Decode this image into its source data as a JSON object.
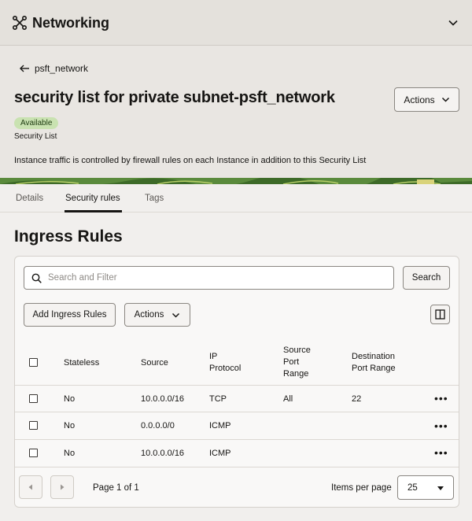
{
  "topbar": {
    "title": "Networking",
    "icon": "network-icon"
  },
  "header": {
    "breadcrumb": "psft_network",
    "title": "security list for private subnet-psft_network",
    "actions_label": "Actions",
    "status": "Available",
    "resource_type": "Security List",
    "note": "Instance traffic is controlled by firewall rules on each Instance in addition to this Security List"
  },
  "tabs": [
    "Details",
    "Security rules",
    "Tags"
  ],
  "active_tab": "Security rules",
  "section": {
    "title": "Ingress Rules"
  },
  "toolbar": {
    "search_placeholder": "Search and Filter",
    "search_button": "Search",
    "add_button": "Add Ingress Rules",
    "actions_button": "Actions"
  },
  "table": {
    "headers": {
      "stateless": "Stateless",
      "source": "Source",
      "ip_protocol": [
        "IP",
        "Protocol"
      ],
      "source_port": [
        "Source",
        "Port",
        "Range"
      ],
      "dest_port": [
        "Destination",
        "Port Range"
      ]
    },
    "rows": [
      {
        "stateless": "No",
        "source": "10.0.0.0/16",
        "protocol": "TCP",
        "source_port": "All",
        "dest_port": "22"
      },
      {
        "stateless": "No",
        "source": "0.0.0.0/0",
        "protocol": "ICMP",
        "source_port": "",
        "dest_port": ""
      },
      {
        "stateless": "No",
        "source": "10.0.0.0/16",
        "protocol": "ICMP",
        "source_port": "",
        "dest_port": ""
      }
    ]
  },
  "pagination": {
    "page_text": "Page 1 of 1",
    "items_per_page_label": "Items per page",
    "items_per_page": "25"
  }
}
